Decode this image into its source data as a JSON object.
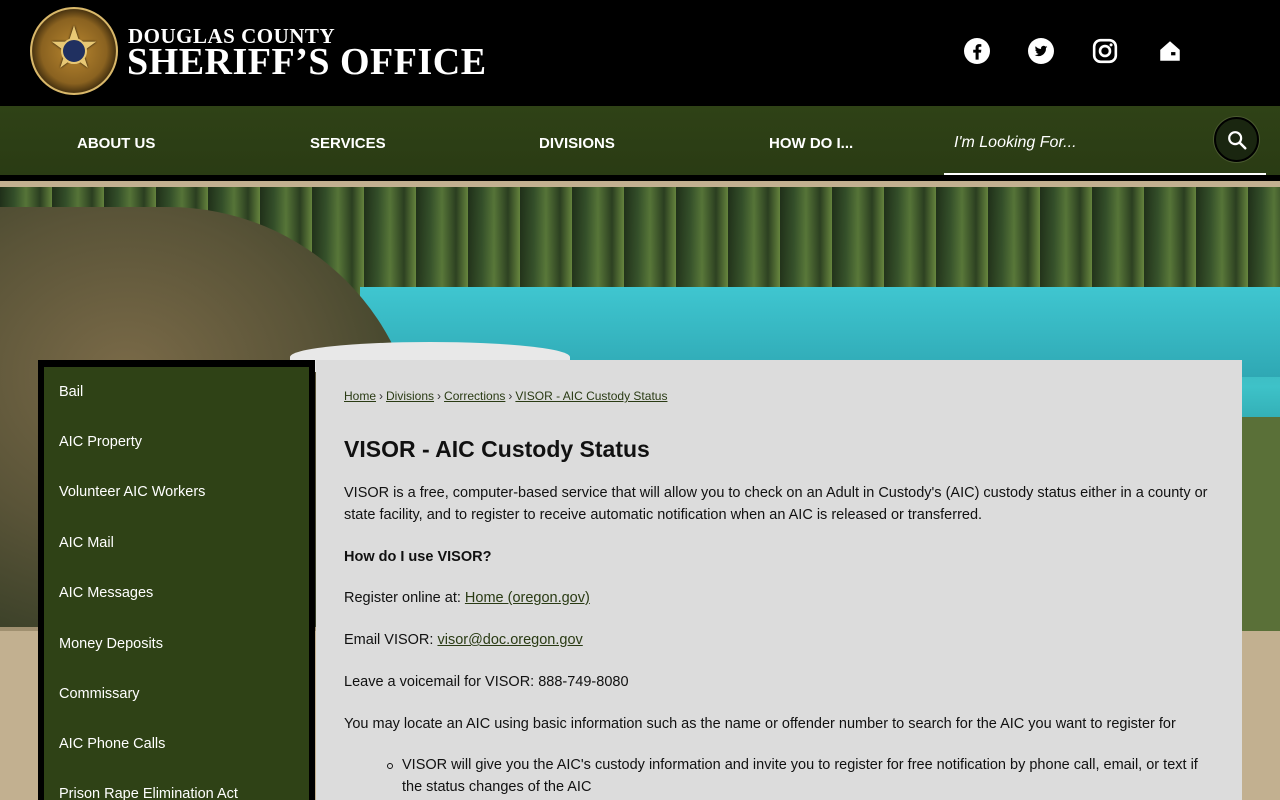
{
  "header": {
    "brand_top": "DOUGLAS COUNTY",
    "brand_main": "SHERIFF’S OFFICE",
    "social": [
      {
        "icon": "facebook-icon"
      },
      {
        "icon": "twitter-icon"
      },
      {
        "icon": "instagram-icon"
      },
      {
        "icon": "home-icon"
      }
    ]
  },
  "nav": {
    "items": [
      "ABOUT US",
      "SERVICES",
      "DIVISIONS",
      "HOW DO I..."
    ],
    "search_placeholder": "I'm Looking For..."
  },
  "sidebar": {
    "items": [
      "Bail",
      "AIC Property",
      "Volunteer AIC Workers",
      "AIC Mail",
      "AIC Messages",
      "Money Deposits",
      "Commissary",
      "AIC Phone Calls",
      "Prison Rape Elimination Act"
    ]
  },
  "breadcrumb": [
    "Home",
    "Divisions",
    "Corrections",
    "VISOR - AIC Custody Status"
  ],
  "content": {
    "title": "VISOR - AIC Custody Status",
    "intro": "VISOR is a free, computer-based service that will allow you to check on an Adult in Custody's (AIC) custody status either in a county or state facility, and to register to receive automatic notification when an AIC is released or transferred.",
    "how_heading": "How do I use VISOR?",
    "register_label": "Register online at:",
    "register_link": "Home (oregon.gov)",
    "email_label": "Email VISOR:",
    "email_link": "visor@doc.oregon.gov",
    "voicemail": "Leave a voicemail for VISOR: 888-749-8080",
    "locate": "You may locate an AIC using basic information such as the name or offender number to search for the AIC you want to register for",
    "bullet1": "VISOR will give you the AIC's custody information and invite you to register for free notification by phone call, email, or text if the status changes of the AIC"
  },
  "colors": {
    "nav_green": "#2f4216",
    "content_bg": "#dcdcdc",
    "link": "#2a3b14"
  }
}
